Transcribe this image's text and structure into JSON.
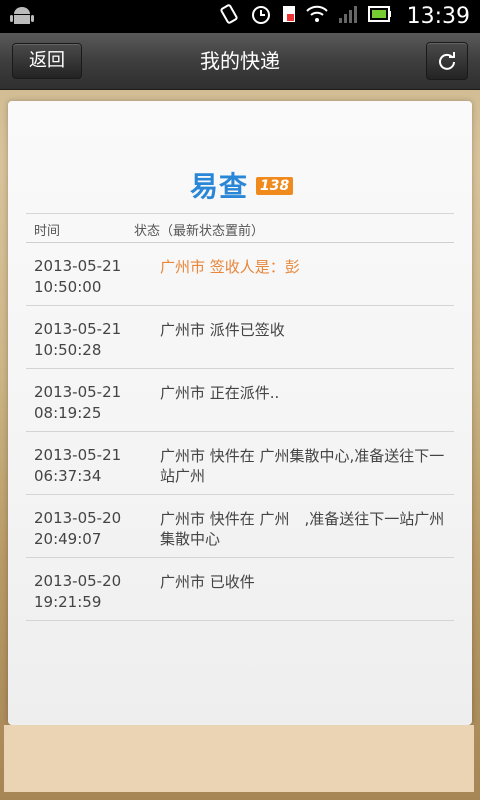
{
  "status_bar": {
    "time": "13:39",
    "icons": [
      "android-icon",
      "vibrate-icon",
      "alarm-icon",
      "sim-icon",
      "wifi-icon",
      "signal-icon",
      "battery-icon"
    ]
  },
  "header": {
    "back_label": "返回",
    "title": "我的快递"
  },
  "logo": {
    "main": "易查",
    "sub": "138",
    "colors": {
      "main": "#2a86d6",
      "sub_bg": "#f08a1c"
    }
  },
  "table": {
    "headers": {
      "time": "时间",
      "status": "状态（最新状态置前）"
    },
    "rows": [
      {
        "time": "2013-05-21\n10:50:00",
        "status": "广州市 签收人是：彭"
      },
      {
        "time": "2013-05-21\n10:50:28",
        "status": "广州市 派件已签收"
      },
      {
        "time": "2013-05-21\n08:19:25",
        "status": "广州市 正在派件.."
      },
      {
        "time": "2013-05-21\n06:37:34",
        "status": "广州市 快件在 广州集散中心,准备送往下一站广州"
      },
      {
        "time": "2013-05-20\n20:49:07",
        "status": "广州市 快件在 广州　,准备送往下一站广州集散中心"
      },
      {
        "time": "2013-05-20\n19:21:59",
        "status": "广州市 已收件"
      }
    ],
    "latest_color": "#e8863a"
  }
}
